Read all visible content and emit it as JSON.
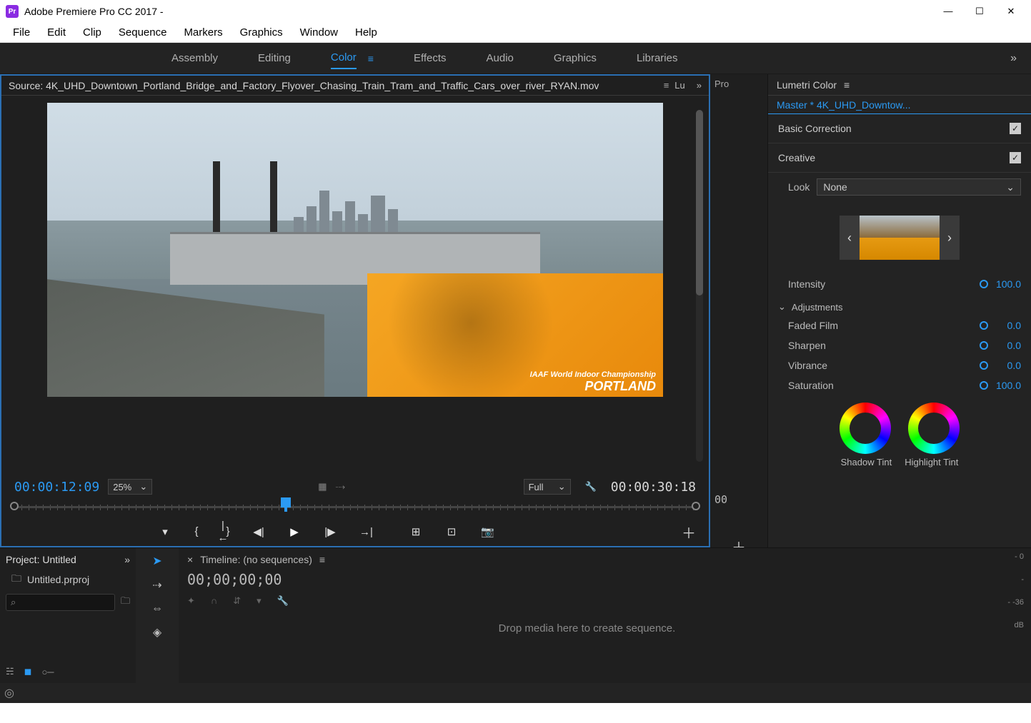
{
  "titlebar": {
    "app_name": "Adobe Premiere Pro CC 2017 -"
  },
  "menubar": [
    "File",
    "Edit",
    "Clip",
    "Sequence",
    "Markers",
    "Graphics",
    "Window",
    "Help"
  ],
  "workspaces": {
    "items": [
      "Assembly",
      "Editing",
      "Color",
      "Effects",
      "Audio",
      "Graphics",
      "Libraries"
    ],
    "active_index": 2
  },
  "source": {
    "prefix": "Source: ",
    "file": "4K_UHD_Downtown_Portland_Bridge_and_Factory_Flyover_Chasing_Train_Tram_and_Traffic_Cars_over_river_RYAN.mov",
    "extra_tabs": [
      "Lu",
      "Pro"
    ],
    "billboard_line1": "IAAF World Indoor Championship",
    "billboard_line2": "PORTLAND",
    "current_tc": "00:00:12:09",
    "total_tc": "00:00:30:18",
    "zoom": "25%",
    "resolution": "Full"
  },
  "mid": {
    "tc": "00"
  },
  "lumetri": {
    "title": "Lumetri Color",
    "master": "Master * 4K_UHD_Downtow...",
    "sections": {
      "basic": "Basic Correction",
      "creative": "Creative"
    },
    "look_label": "Look",
    "look_value": "None",
    "params": {
      "intensity": {
        "label": "Intensity",
        "value": "100.0"
      },
      "adjustments": "Adjustments",
      "faded": {
        "label": "Faded Film",
        "value": "0.0"
      },
      "sharpen": {
        "label": "Sharpen",
        "value": "0.0"
      },
      "vibrance": {
        "label": "Vibrance",
        "value": "0.0"
      },
      "saturation": {
        "label": "Saturation",
        "value": "100.0"
      }
    },
    "wheel_labels": {
      "shadow": "Shadow Tint",
      "highlight": "Highlight Tint"
    }
  },
  "project": {
    "title": "Project: Untitled",
    "file": "Untitled.prproj"
  },
  "timeline": {
    "title": "Timeline: (no sequences)",
    "tc": "00;00;00;00",
    "drop": "Drop media here to create sequence."
  },
  "meters": {
    "scale": [
      "- 0",
      "-",
      "- -36",
      "dB"
    ]
  }
}
